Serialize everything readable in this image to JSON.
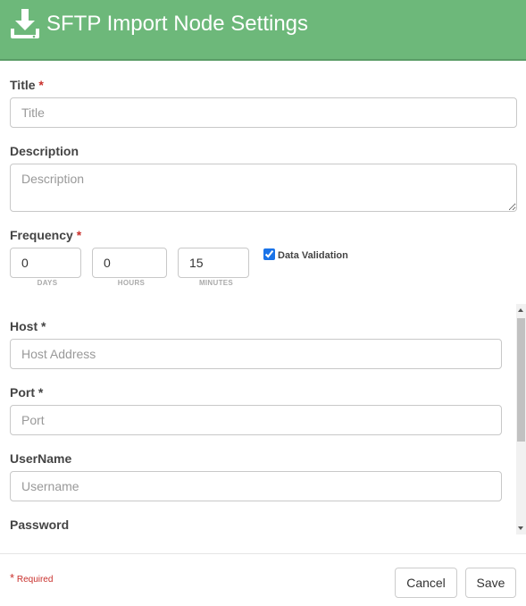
{
  "header": {
    "title": "SFTP Import Node Settings",
    "icon": "download-icon",
    "bg_color": "#6db87a"
  },
  "form": {
    "title": {
      "label": "Title",
      "required_mark": "*",
      "placeholder": "Title",
      "value": ""
    },
    "description": {
      "label": "Description",
      "placeholder": "Description",
      "value": ""
    },
    "frequency": {
      "label": "Frequency",
      "required_mark": "*",
      "days": {
        "value": "0",
        "unit": "DAYS"
      },
      "hours": {
        "value": "0",
        "unit": "HOURS"
      },
      "minutes": {
        "value": "15",
        "unit": "MINUTES"
      }
    },
    "data_validation": {
      "label": "Data Validation",
      "checked": true
    },
    "host": {
      "label": "Host",
      "required_mark": "*",
      "placeholder": "Host Address",
      "value": ""
    },
    "port": {
      "label": "Port",
      "required_mark": "*",
      "placeholder": "Port",
      "value": ""
    },
    "username": {
      "label": "UserName",
      "placeholder": "Username",
      "value": ""
    },
    "password": {
      "label": "Password"
    }
  },
  "footer": {
    "required_mark": "*",
    "required_note": "Required",
    "cancel_label": "Cancel",
    "save_label": "Save"
  }
}
